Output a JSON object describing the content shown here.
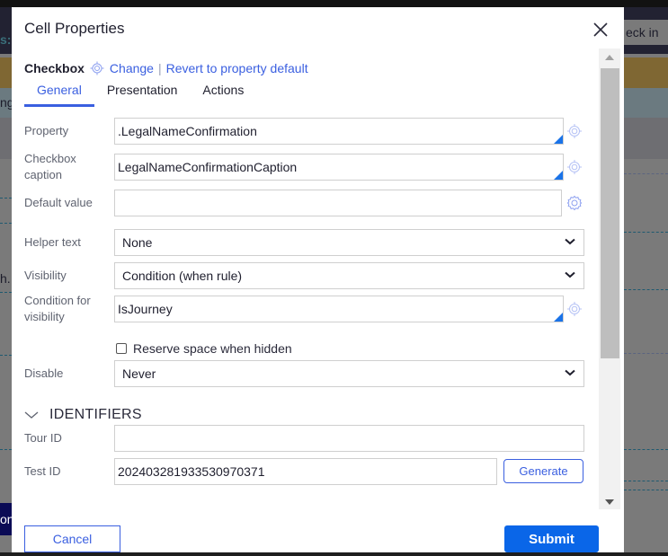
{
  "background": {
    "checkin_text": "eck in",
    "left_fragments": [
      "s:",
      "ng",
      "h.",
      "on"
    ]
  },
  "dialog": {
    "title": "Cell Properties",
    "control_type": "Checkbox",
    "change_link": "Change",
    "separator": "|",
    "revert_link": "Revert to property default",
    "tabs": [
      {
        "label": "General",
        "active": true
      },
      {
        "label": "Presentation",
        "active": false
      },
      {
        "label": "Actions",
        "active": false
      }
    ],
    "fields": {
      "property": {
        "label": "Property",
        "value": ".LegalNameConfirmation"
      },
      "checkbox_caption": {
        "label": "Checkbox caption",
        "value": "LegalNameConfirmationCaption"
      },
      "default_value": {
        "label": "Default value",
        "value": ""
      },
      "helper_text": {
        "label": "Helper text",
        "value": "None"
      },
      "visibility": {
        "label": "Visibility",
        "value": "Condition (when rule)"
      },
      "condition_for_visibility": {
        "label": "Condition for visibility",
        "value": "IsJourney"
      },
      "reserve_space": {
        "label": "Reserve space when hidden",
        "checked": false
      },
      "disable": {
        "label": "Disable",
        "value": "Never"
      }
    },
    "identifiers": {
      "heading": "IDENTIFIERS",
      "tour_id": {
        "label": "Tour ID",
        "value": ""
      },
      "test_id": {
        "label": "Test ID",
        "value": "20240328193353097037​1"
      },
      "generate_label": "Generate"
    },
    "footer": {
      "cancel_label": "Cancel",
      "submit_label": "Submit"
    },
    "colors": {
      "accent": "#3a5fe0",
      "primary_button": "#0a66e8",
      "corner_marker": "#1a73e8"
    }
  }
}
